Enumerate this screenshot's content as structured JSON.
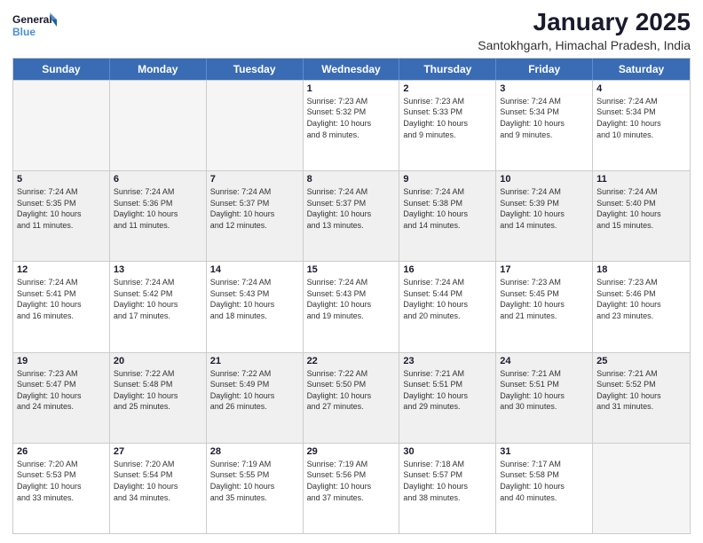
{
  "logo": {
    "line1": "General",
    "line2": "Blue"
  },
  "header": {
    "month": "January 2025",
    "location": "Santokhgarh, Himachal Pradesh, India"
  },
  "days_of_week": [
    "Sunday",
    "Monday",
    "Tuesday",
    "Wednesday",
    "Thursday",
    "Friday",
    "Saturday"
  ],
  "rows": [
    [
      {
        "day": "",
        "empty": true
      },
      {
        "day": "",
        "empty": true
      },
      {
        "day": "",
        "empty": true
      },
      {
        "day": "1",
        "sunrise": "7:23 AM",
        "sunset": "5:32 PM",
        "daylight": "10 hours and 8 minutes."
      },
      {
        "day": "2",
        "sunrise": "7:23 AM",
        "sunset": "5:33 PM",
        "daylight": "10 hours and 9 minutes."
      },
      {
        "day": "3",
        "sunrise": "7:24 AM",
        "sunset": "5:34 PM",
        "daylight": "10 hours and 9 minutes."
      },
      {
        "day": "4",
        "sunrise": "7:24 AM",
        "sunset": "5:34 PM",
        "daylight": "10 hours and 10 minutes."
      }
    ],
    [
      {
        "day": "5",
        "sunrise": "7:24 AM",
        "sunset": "5:35 PM",
        "daylight": "10 hours and 11 minutes."
      },
      {
        "day": "6",
        "sunrise": "7:24 AM",
        "sunset": "5:36 PM",
        "daylight": "10 hours and 11 minutes."
      },
      {
        "day": "7",
        "sunrise": "7:24 AM",
        "sunset": "5:37 PM",
        "daylight": "10 hours and 12 minutes."
      },
      {
        "day": "8",
        "sunrise": "7:24 AM",
        "sunset": "5:37 PM",
        "daylight": "10 hours and 13 minutes."
      },
      {
        "day": "9",
        "sunrise": "7:24 AM",
        "sunset": "5:38 PM",
        "daylight": "10 hours and 14 minutes."
      },
      {
        "day": "10",
        "sunrise": "7:24 AM",
        "sunset": "5:39 PM",
        "daylight": "10 hours and 14 minutes."
      },
      {
        "day": "11",
        "sunrise": "7:24 AM",
        "sunset": "5:40 PM",
        "daylight": "10 hours and 15 minutes."
      }
    ],
    [
      {
        "day": "12",
        "sunrise": "7:24 AM",
        "sunset": "5:41 PM",
        "daylight": "10 hours and 16 minutes."
      },
      {
        "day": "13",
        "sunrise": "7:24 AM",
        "sunset": "5:42 PM",
        "daylight": "10 hours and 17 minutes."
      },
      {
        "day": "14",
        "sunrise": "7:24 AM",
        "sunset": "5:43 PM",
        "daylight": "10 hours and 18 minutes."
      },
      {
        "day": "15",
        "sunrise": "7:24 AM",
        "sunset": "5:43 PM",
        "daylight": "10 hours and 19 minutes."
      },
      {
        "day": "16",
        "sunrise": "7:24 AM",
        "sunset": "5:44 PM",
        "daylight": "10 hours and 20 minutes."
      },
      {
        "day": "17",
        "sunrise": "7:23 AM",
        "sunset": "5:45 PM",
        "daylight": "10 hours and 21 minutes."
      },
      {
        "day": "18",
        "sunrise": "7:23 AM",
        "sunset": "5:46 PM",
        "daylight": "10 hours and 23 minutes."
      }
    ],
    [
      {
        "day": "19",
        "sunrise": "7:23 AM",
        "sunset": "5:47 PM",
        "daylight": "10 hours and 24 minutes."
      },
      {
        "day": "20",
        "sunrise": "7:22 AM",
        "sunset": "5:48 PM",
        "daylight": "10 hours and 25 minutes."
      },
      {
        "day": "21",
        "sunrise": "7:22 AM",
        "sunset": "5:49 PM",
        "daylight": "10 hours and 26 minutes."
      },
      {
        "day": "22",
        "sunrise": "7:22 AM",
        "sunset": "5:50 PM",
        "daylight": "10 hours and 27 minutes."
      },
      {
        "day": "23",
        "sunrise": "7:21 AM",
        "sunset": "5:51 PM",
        "daylight": "10 hours and 29 minutes."
      },
      {
        "day": "24",
        "sunrise": "7:21 AM",
        "sunset": "5:51 PM",
        "daylight": "10 hours and 30 minutes."
      },
      {
        "day": "25",
        "sunrise": "7:21 AM",
        "sunset": "5:52 PM",
        "daylight": "10 hours and 31 minutes."
      }
    ],
    [
      {
        "day": "26",
        "sunrise": "7:20 AM",
        "sunset": "5:53 PM",
        "daylight": "10 hours and 33 minutes."
      },
      {
        "day": "27",
        "sunrise": "7:20 AM",
        "sunset": "5:54 PM",
        "daylight": "10 hours and 34 minutes."
      },
      {
        "day": "28",
        "sunrise": "7:19 AM",
        "sunset": "5:55 PM",
        "daylight": "10 hours and 35 minutes."
      },
      {
        "day": "29",
        "sunrise": "7:19 AM",
        "sunset": "5:56 PM",
        "daylight": "10 hours and 37 minutes."
      },
      {
        "day": "30",
        "sunrise": "7:18 AM",
        "sunset": "5:57 PM",
        "daylight": "10 hours and 38 minutes."
      },
      {
        "day": "31",
        "sunrise": "7:17 AM",
        "sunset": "5:58 PM",
        "daylight": "10 hours and 40 minutes."
      },
      {
        "day": "",
        "empty": true
      }
    ]
  ],
  "labels": {
    "sunrise": "Sunrise:",
    "sunset": "Sunset:",
    "daylight": "Daylight:"
  }
}
